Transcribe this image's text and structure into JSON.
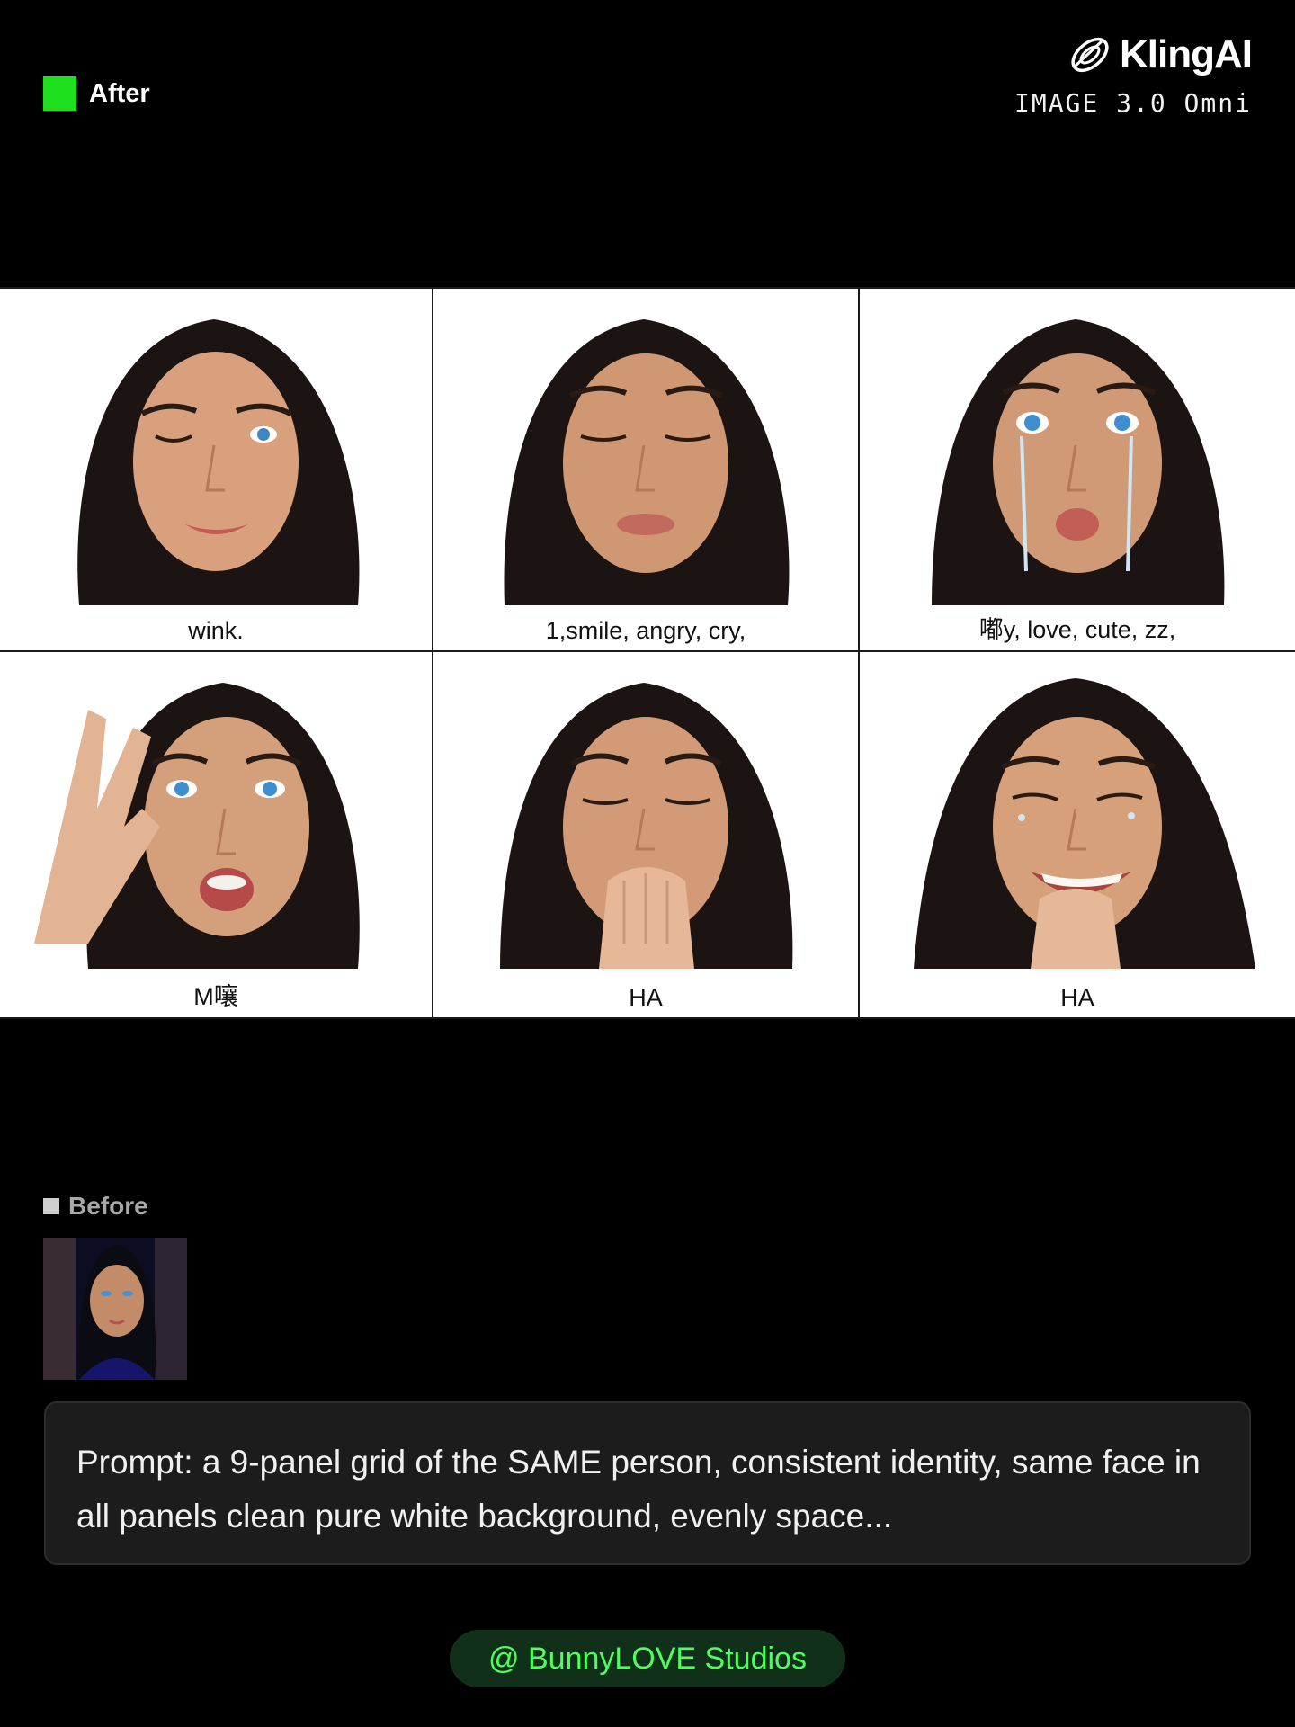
{
  "header": {
    "after_label": "After",
    "after_color": "#1fe01f",
    "brand_name": "KlingAI",
    "brand_subtitle": "IMAGE 3.0 Omni",
    "brand_icon": "kling-logo-icon"
  },
  "grid": {
    "panels": [
      {
        "caption": "wink.",
        "expression": "wink"
      },
      {
        "caption": "1,smile, angry, cry,",
        "expression": "eyes-closed"
      },
      {
        "caption": "嘟y, love, cute, zz,",
        "expression": "pout-cry"
      },
      {
        "caption": "M嚷",
        "expression": "surprised-hand"
      },
      {
        "caption": "HA",
        "expression": "hand-over-mouth"
      },
      {
        "caption": "HA",
        "expression": "laugh-cry"
      }
    ]
  },
  "before": {
    "label": "Before"
  },
  "prompt": {
    "text": "Prompt: a 9-panel grid of the SAME person, consistent identity, same face in all panels clean pure white background, evenly space..."
  },
  "credit": {
    "text": "@ BunnyLOVE Studios",
    "color": "#4cff5c"
  }
}
